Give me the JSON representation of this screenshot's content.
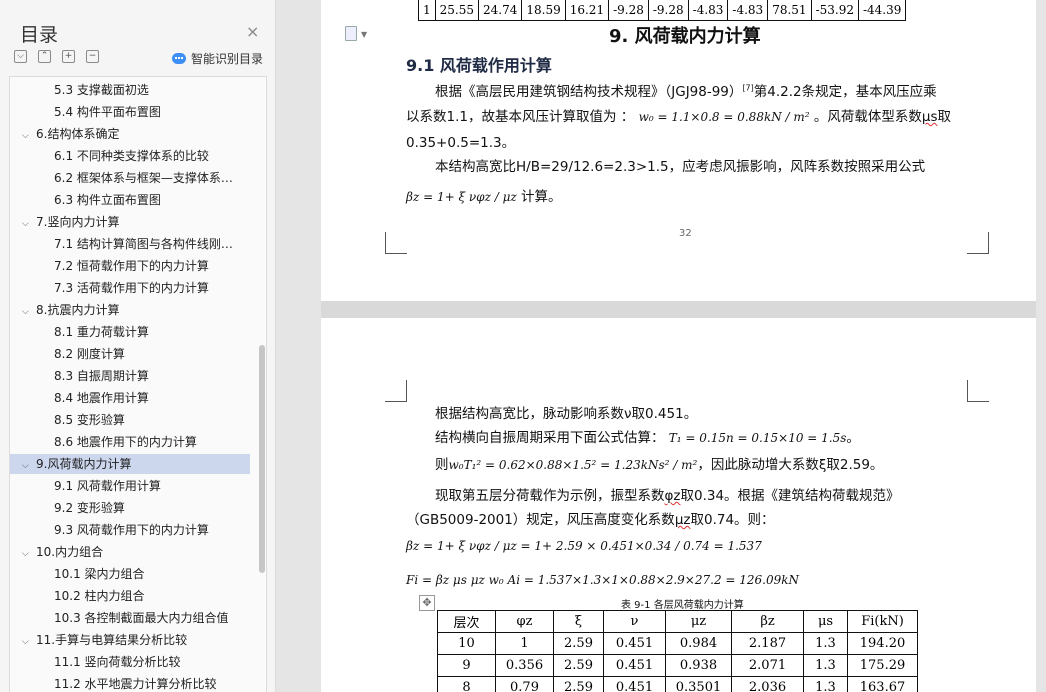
{
  "sidebar": {
    "title": "目录",
    "close_label": "×",
    "smart_label": "智能识别目录",
    "toolbar": {
      "collapse": "⌵",
      "expand": "⌃",
      "add": "+",
      "remove": "−"
    },
    "items": [
      {
        "label": "5.3  支撑截面初选",
        "level": 2
      },
      {
        "label": "5.4  构件平面布置图",
        "level": 2
      },
      {
        "label": "6.结构体系确定",
        "level": 1
      },
      {
        "label": "6.1 不同种类支撑体系的比较",
        "level": 2
      },
      {
        "label": "6.2  框架体系与框架—支撑体系…",
        "level": 2
      },
      {
        "label": "6.3  构件立面布置图",
        "level": 2
      },
      {
        "label": "7.竖向内力计算",
        "level": 1
      },
      {
        "label": "7.1  结构计算简图与各构件线刚…",
        "level": 2
      },
      {
        "label": "7.2  恒荷载作用下的内力计算",
        "level": 2
      },
      {
        "label": "7.3  活荷载作用下的内力计算",
        "level": 2
      },
      {
        "label": "8.抗震内力计算",
        "level": 1
      },
      {
        "label": "8.1  重力荷载计算",
        "level": 2
      },
      {
        "label": "8.2  刚度计算",
        "level": 2
      },
      {
        "label": "8.3  自振周期计算",
        "level": 2
      },
      {
        "label": "8.4  地震作用计算",
        "level": 2
      },
      {
        "label": "8.5  变形验算",
        "level": 2
      },
      {
        "label": "8.6  地震作用下的内力计算",
        "level": 2
      },
      {
        "label": "9.风荷载内力计算",
        "level": 1,
        "active": true
      },
      {
        "label": "9.1  风荷载作用计算",
        "level": 2
      },
      {
        "label": "9.2  变形验算",
        "level": 2
      },
      {
        "label": "9.3  风荷载作用下的内力计算",
        "level": 2
      },
      {
        "label": "10.内力组合",
        "level": 1
      },
      {
        "label": "10.1  梁内力组合",
        "level": 2
      },
      {
        "label": "10.2  柱内力组合",
        "level": 2
      },
      {
        "label": "10.3  各控制截面最大内力组合值",
        "level": 2
      },
      {
        "label": "11.手算与电算结果分析比较",
        "level": 1
      },
      {
        "label": "11.1  竖向荷载分析比较",
        "level": 2
      },
      {
        "label": "11.2  水平地震力计算分析比较",
        "level": 2
      }
    ]
  },
  "page1": {
    "top_row": [
      "1",
      "25.55",
      "24.74",
      "18.59",
      "16.21",
      "-9.28",
      "-9.28",
      "-4.83",
      "-4.83",
      "78.51",
      "-53.92",
      "-44.39"
    ],
    "chapter_title": "9. 风荷载内力计算",
    "section_title": "9.1  风荷载作用计算",
    "p1a": "根据《高层民用建筑钢结构技术规程》（JGJ98-99）",
    "p1ref": "[7]",
    "p1b": "第4.2.2条规定，基本风压应乘",
    "p2a": "以系数1.1，故基本风压计算取值为 ：",
    "p2math": "w₀ = 1.1×0.8 = 0.88kN / m²",
    "p2b": "。风荷载体型系数",
    "p2mu": "μs",
    "p2c": "取",
    "p3": "0.35+0.5=1.3。",
    "p4": "本结构高宽比H/B=29/12.6=2.3>1.5，应考虑风振影响，风阵系数按照采用公式",
    "p5math": "βz = 1+ ξ νφz / μz",
    "p5text": "计算。",
    "page_number": "32"
  },
  "page2": {
    "l1": "根据结构高宽比，脉动影响系数ν取0.451。",
    "l2a": "结构横向自振周期采用下面公式估算：",
    "l2math": "T₁ = 0.15n = 0.15×10 = 1.5s",
    "l2b": "。",
    "l3a": "则",
    "l3math": "w₀T₁² = 0.62×0.88×1.5² = 1.23kNs² / m²",
    "l3b": "，因此脉动增大系数ξ取2.59。",
    "l4a": "现取第五层分荷载作为示例，振型系数",
    "l4phi": "φz",
    "l4b": "取0.34。根据《建筑结构荷载规范》",
    "l5a": "（GB5009-2001）规定，风压高度变化系数",
    "l5mu": "μz",
    "l5b": "取0.74。则：",
    "eq1": "βz = 1+ ξ νφz / μz = 1+ 2.59 × 0.451×0.34 / 0.74 = 1.537",
    "eq2": "Fi = βz μs μz w₀ Ai = 1.537×1.3×1×0.88×2.9×27.2 = 126.09kN",
    "table_caption": "表 9-1  各层风荷载内力计算",
    "table_headers": [
      "层次",
      "φz",
      "ξ",
      "ν",
      "μz",
      "βz",
      "μs",
      "Fi(kN)"
    ],
    "table_rows": [
      [
        "10",
        "1",
        "2.59",
        "0.451",
        "0.984",
        "2.187",
        "1.3",
        "194.20"
      ],
      [
        "9",
        "0.356",
        "2.59",
        "0.451",
        "0.938",
        "2.071",
        "1.3",
        "175.29"
      ],
      [
        "8",
        "0.79",
        "2.59",
        "0.451",
        "0.3501",
        "2.036",
        "1.3",
        "163.67"
      ]
    ]
  }
}
